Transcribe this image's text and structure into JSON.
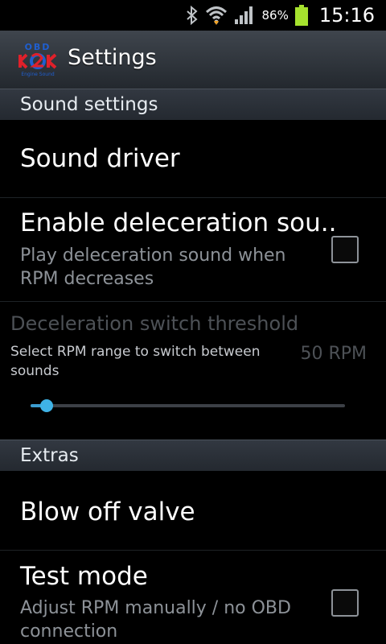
{
  "status_bar": {
    "icons": [
      "bluetooth-icon",
      "wifi-icon",
      "signal-icon",
      "battery-icon"
    ],
    "battery_percent": "86%",
    "time": "15:16"
  },
  "action_bar": {
    "logo_text_top": "OBD",
    "logo_text_bottom": "Engine Sound",
    "title": "Settings"
  },
  "categories": {
    "sound_settings": "Sound settings",
    "extras": "Extras"
  },
  "prefs": {
    "sound_driver": {
      "title": "Sound driver"
    },
    "enable_deceleration": {
      "title": "Enable deleceration sou..",
      "summary": "Play deleceration sound when RPM decreases",
      "checked": false
    },
    "deceleration_threshold": {
      "title": "Deceleration switch threshold",
      "summary": "Select RPM range to switch between sounds",
      "value": "50 RPM",
      "slider_fraction": 0.05,
      "enabled": false
    },
    "blow_off_valve": {
      "title": "Blow off valve"
    },
    "test_mode": {
      "title": "Test mode",
      "summary": "Adjust RPM manually / no OBD connection",
      "checked": false
    }
  },
  "colors": {
    "accent": "#3fb3e6",
    "logo_red": "#e0202a",
    "logo_blue": "#1f5fd0",
    "battery": "#a6e22e"
  }
}
